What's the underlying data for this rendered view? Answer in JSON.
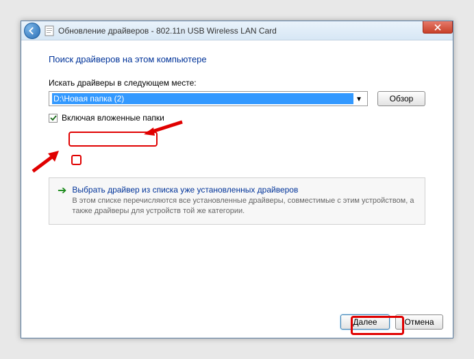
{
  "titlebar": {
    "title": "Обновление драйверов - 802.11n USB Wireless LAN Card"
  },
  "main": {
    "heading": "Поиск драйверов на этом компьютере",
    "pathLabel": "Искать драйверы в следующем месте:",
    "pathValue": "D:\\Новая папка (2)",
    "browseBtn": "Обзор",
    "includeSubfolders": "Включая вложенные папки",
    "infobox": {
      "title": "Выбрать драйвер из списка уже установленных драйверов",
      "desc": "В этом списке перечисляются все установленные драйверы, совместимые с этим устройством, а также драйверы для устройств той же категории."
    }
  },
  "footer": {
    "next": "Далее",
    "cancel": "Отмена"
  }
}
